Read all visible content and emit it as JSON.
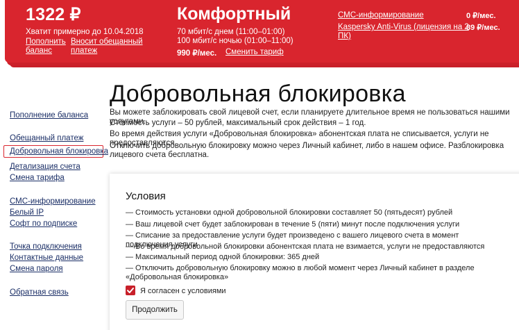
{
  "header": {
    "balance": {
      "amount": "1322 ₽",
      "until": "Хватит примерно до 10.04.2018",
      "topup_link": "Пополнить баланс",
      "promise_link": "Вносит обещанный платеж"
    },
    "tariff": {
      "name": "Комфортный",
      "speed_day": "70 мбит/с днем (11:00–01:00)",
      "speed_night": "100 мбит/с ночью (01:00–11:00)",
      "price": "990 ₽/мес.",
      "change_link": "Сменить тариф"
    },
    "services": [
      {
        "name": "СМС-информирование",
        "price": "0 ₽/мес."
      },
      {
        "name": "Kaspersky Anti-Virus (лицензия на 2 ПК)",
        "price": "89 ₽/мес."
      }
    ]
  },
  "sidebar": {
    "items": [
      {
        "label": "Пополнение баланса"
      },
      {
        "label": "Обещанный платеж"
      },
      {
        "label": "Добровольная блокировка",
        "active": true
      },
      {
        "label": "Детализация счета"
      },
      {
        "label": "Смена тарифа"
      },
      {
        "label": "СМС-информирование"
      },
      {
        "label": "Белый IP"
      },
      {
        "label": "Софт по подписке"
      },
      {
        "label": "Точка подключения"
      },
      {
        "label": "Контактные данные"
      },
      {
        "label": "Смена пароля"
      },
      {
        "label": "Обратная связь"
      }
    ]
  },
  "main": {
    "title": "Добровольная блокировка",
    "intro": [
      "Вы можете заблокировать свой лицевой счет, если планируете длительное время не пользоваться нашими услугами.",
      "Стоимость услуги – 50 рублей, максимальный срок действия – 1 год.",
      "Во время действия услуги «Добровольная блокировка» абонентская плата не списывается, услуги не предоставляются.",
      "Отключить добровольную блокировку можно через Личный кабинет, либо в нашем офисе. Разблокировка лицевого счета бесплатна."
    ],
    "conditions": {
      "title": "Условия",
      "items": [
        "— Стоимость установки одной добровольной блокировки составляет 50 (пятьдесят) рублей",
        "— Ваш лицевой счет будет заблокирован в течение 5 (пяти) минут после подключения услуги",
        "— Списание за предоставление услуги будет произведено с вашего лицевого счета в момент подключения услуги",
        "— Во время добровольной блокировки абонентская плата не взимается, услуги не предоставляются",
        "— Максимальный период одной блокировки: 365 дней",
        "— Отключить добровольную блокировку можно в любой момент через Личный кабинет в разделе «Добровольная блокировка»"
      ],
      "agree_label": "Я согласен с условиями",
      "agree_checked": true,
      "continue_label": "Продолжить"
    }
  },
  "colors": {
    "brand": "#d9252e",
    "link": "#1a2e66"
  }
}
